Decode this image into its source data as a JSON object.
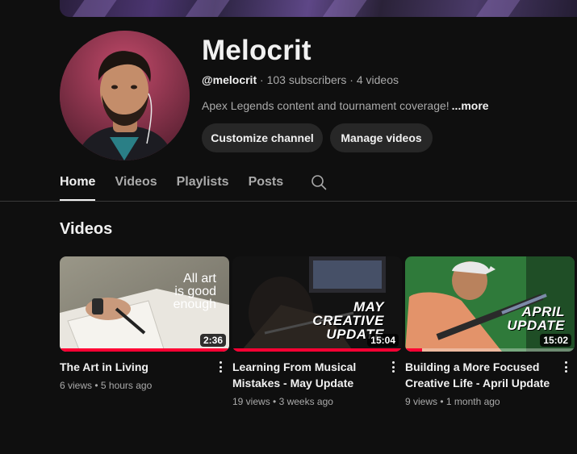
{
  "channel": {
    "name": "Melocrit",
    "handle": "@melocrit",
    "subscribers": "103 subscribers",
    "videos_count": "4 videos",
    "separator": "·",
    "description": "Apex Legends content and tournament coverage!",
    "more_label": "...more",
    "customize_label": "Customize channel",
    "manage_label": "Manage videos"
  },
  "tabs": [
    {
      "label": "Home",
      "active": true
    },
    {
      "label": "Videos",
      "active": false
    },
    {
      "label": "Playlists",
      "active": false
    },
    {
      "label": "Posts",
      "active": false
    }
  ],
  "search_icon": "search-icon",
  "section_title": "Videos",
  "videos": [
    {
      "title": "The Art in Living",
      "views": "6 views",
      "age": "5 hours ago",
      "duration": "2:36",
      "thumb_text": [
        "All art",
        "is good",
        "enough"
      ],
      "watched_fraction": 1.0
    },
    {
      "title": "Learning From Musical Mistakes - May Update",
      "views": "19 views",
      "age": "3 weeks ago",
      "duration": "15:04",
      "thumb_text": [
        "MAY",
        "CREATIVE",
        "UPDATE"
      ],
      "watched_fraction": 1.0
    },
    {
      "title": "Building a More Focused Creative Life - April Update",
      "views": "9 views",
      "age": "1 month ago",
      "duration": "15:02",
      "thumb_text": [
        "APRIL",
        "UPDATE"
      ],
      "watched_fraction": 0.1
    }
  ],
  "colors": {
    "background": "#0f0f0f",
    "chip": "#272727",
    "progress": "#ff0033",
    "secondary_text": "#aaaaaa"
  }
}
